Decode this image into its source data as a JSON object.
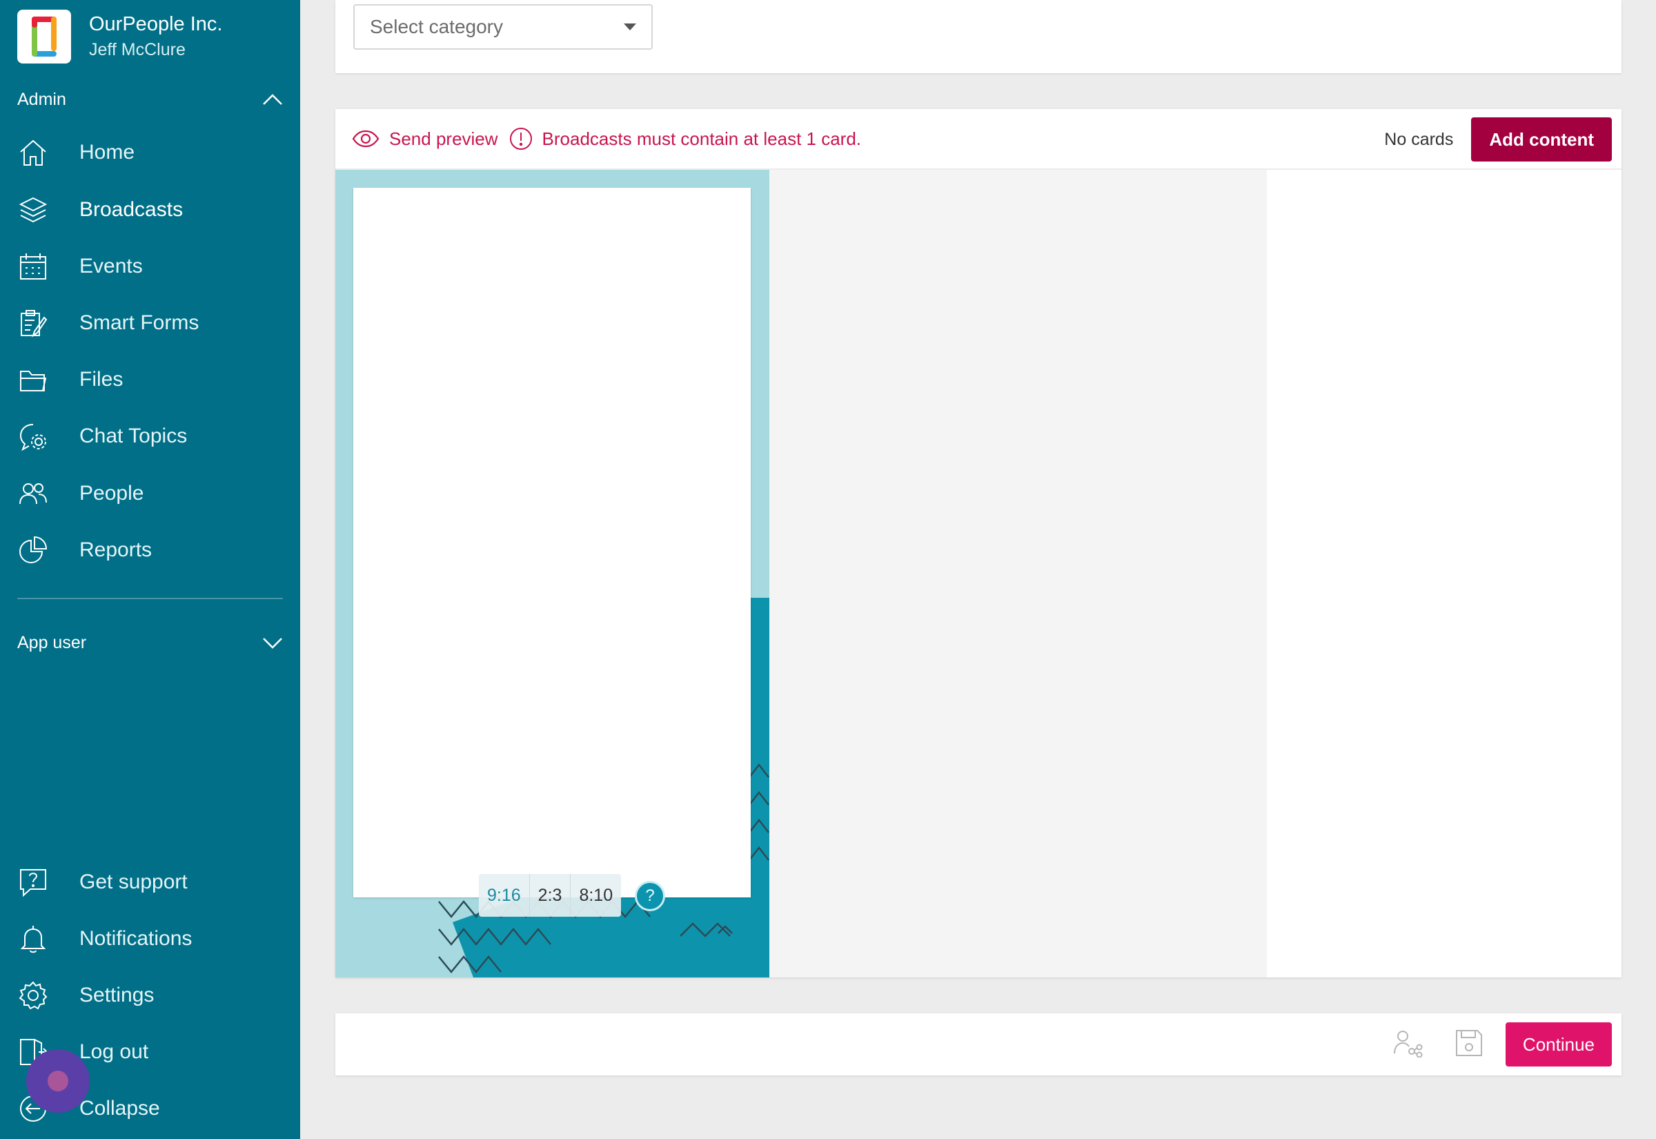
{
  "app": {
    "org_name": "OurPeople Inc.",
    "user_name": "Jeff McClure"
  },
  "sidebar": {
    "admin_section": {
      "label": "Admin",
      "icon": "chevron-up-icon"
    },
    "admin_items": [
      {
        "label": "Home",
        "icon": "home-icon"
      },
      {
        "label": "Broadcasts",
        "icon": "layers-icon",
        "active": true
      },
      {
        "label": "Events",
        "icon": "calendar-icon"
      },
      {
        "label": "Smart Forms",
        "icon": "form-icon"
      },
      {
        "label": "Files",
        "icon": "folder-icon"
      },
      {
        "label": "Chat Topics",
        "icon": "chat-settings-icon"
      },
      {
        "label": "People",
        "icon": "people-icon"
      },
      {
        "label": "Reports",
        "icon": "pie-chart-icon"
      }
    ],
    "app_user_section": {
      "label": "App user",
      "icon": "chevron-down-icon"
    },
    "bottom_items": [
      {
        "label": "Get support",
        "icon": "help-icon"
      },
      {
        "label": "Notifications",
        "icon": "bell-icon"
      },
      {
        "label": "Settings",
        "icon": "gear-icon"
      },
      {
        "label": "Log out",
        "icon": "logout-icon"
      },
      {
        "label": "Collapse",
        "icon": "collapse-icon"
      }
    ]
  },
  "category": {
    "placeholder": "Select category"
  },
  "editor": {
    "send_preview": "Send preview",
    "warning": "Broadcasts must contain at least 1 card.",
    "card_count": "No cards",
    "add_content": "Add content",
    "aspect_ratios": [
      {
        "label": "9:16",
        "selected": true
      },
      {
        "label": "2:3",
        "selected": false
      },
      {
        "label": "8:10",
        "selected": false
      }
    ],
    "help_symbol": "?"
  },
  "footer": {
    "continue": "Continue"
  },
  "colors": {
    "sidebar_bg": "#006f87",
    "accent_red": "#c8154e",
    "add_button": "#a3003f",
    "continue_button": "#e0136a",
    "preview_bg": "#a7d9e0"
  }
}
